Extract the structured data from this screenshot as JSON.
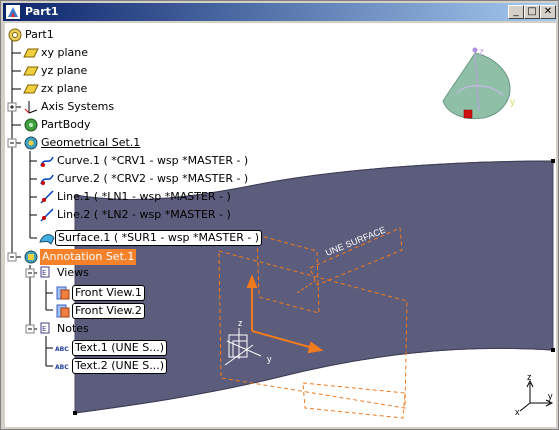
{
  "window": {
    "title": "Part1",
    "min_label": "_",
    "max_label": "□",
    "close_label": "✕"
  },
  "tree": {
    "root": "Part1",
    "xy_plane": "xy plane",
    "yz_plane": "yz plane",
    "zx_plane": "zx plane",
    "axis_systems": "Axis Systems",
    "part_body": "PartBody",
    "geometrical_set": "Geometrical Set.1",
    "curve1": "Curve.1 ( *CRV1 - wsp *MASTER - )",
    "curve2": "Curve.2 ( *CRV2 - wsp *MASTER - )",
    "line1": "Line.1 ( *LN1 - wsp *MASTER - )",
    "line2": "Line.2 ( *LN2 - wsp *MASTER - )",
    "surface1": "Surface.1 ( *SUR1 - wsp *MASTER - )",
    "annotation_set": "Annotation Set.1",
    "views": "Views",
    "front_view1": "Front View.1",
    "front_view2": "Front View.2",
    "notes": "Notes",
    "text1": "Text.1 (UNE S...)",
    "text2": "Text.2 (UNE S...)"
  },
  "viewport": {
    "annotation_text": "UNE SURFACE",
    "compass_z": "z",
    "compass_y": "y",
    "axis_z": "z",
    "axis_y": "y",
    "axis_x": "x"
  },
  "colors": {
    "surface": "#5c5c7c",
    "annotation_orange": "#f07a1e",
    "highlight_orange": "#f5822a",
    "compass_green": "#8fbfa6",
    "titlebar_start": "#0a246a"
  }
}
